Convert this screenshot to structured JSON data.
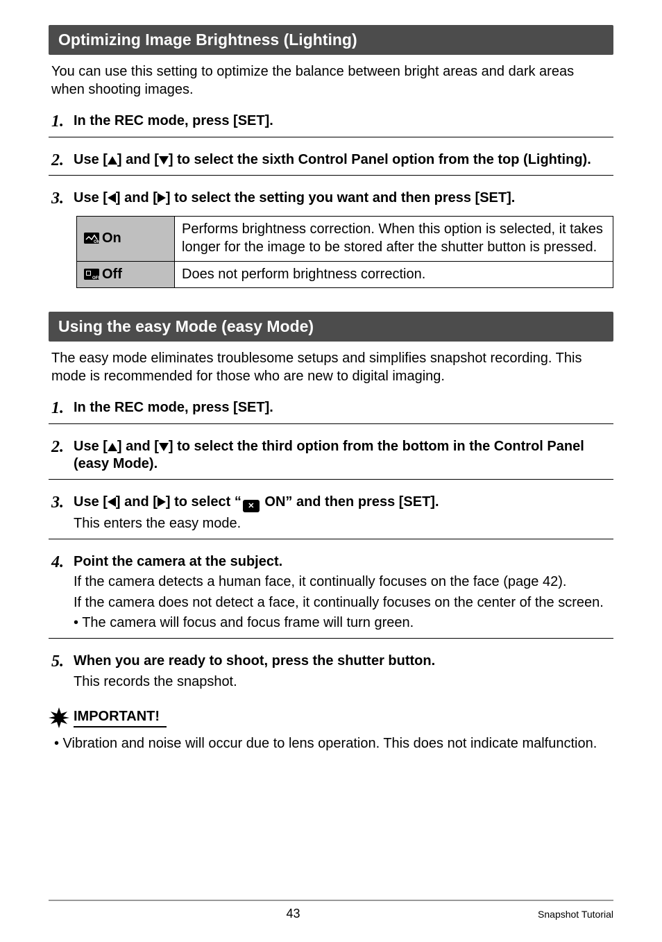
{
  "sections": {
    "lighting": {
      "title": "Optimizing Image Brightness (Lighting)",
      "intro": "You can use this setting to optimize the balance between bright areas and dark areas when shooting images.",
      "steps": {
        "s1": "In the REC mode, press [SET].",
        "s2_pre": "Use [",
        "s2_mid": "] and [",
        "s2_post": "] to select the sixth Control Panel option from the top (Lighting).",
        "s3_pre": "Use [",
        "s3_mid": "] and [",
        "s3_post": "] to select the setting you want and then press [SET]."
      },
      "table": {
        "on_label": "On",
        "on_desc": "Performs brightness correction. When this option is selected, it takes longer for the image to be stored after the shutter button is pressed.",
        "off_label": "Off",
        "off_desc": "Does not perform brightness correction."
      }
    },
    "easy": {
      "title": "Using the easy Mode (easy Mode)",
      "intro": "The easy mode eliminates troublesome setups and simplifies snapshot recording. This mode is recommended for those who are new to digital imaging.",
      "steps": {
        "s1": "In the REC mode, press [SET].",
        "s2_pre": "Use [",
        "s2_mid": "] and [",
        "s2_post": "] to select the third option from the bottom in the Control Panel (easy Mode).",
        "s3_pre": "Use [",
        "s3_mid": "] and [",
        "s3_post1": "] to select “",
        "s3_post2": " ON” and then press [SET].",
        "s3_sub": "This enters the easy mode.",
        "s4": "Point the camera at the subject.",
        "s4_sub1": "If the camera detects a human face, it continually focuses on the face (page 42).",
        "s4_sub2": "If the camera does not detect a face, it continually focuses on the center of the screen.",
        "s4_bullet": "• The camera will focus and focus frame will turn green.",
        "s5": "When you are ready to shoot, press the shutter button.",
        "s5_sub": "This records the snapshot."
      }
    },
    "important": {
      "label": "IMPORTANT!",
      "bullet": "• Vibration and noise will occur due to lens operation. This does not indicate malfunction."
    }
  },
  "step_numbers": {
    "n1": "1.",
    "n2": "2.",
    "n3": "3.",
    "n4": "4.",
    "n5": "5."
  },
  "footer": {
    "page": "43",
    "section": "Snapshot Tutorial"
  }
}
